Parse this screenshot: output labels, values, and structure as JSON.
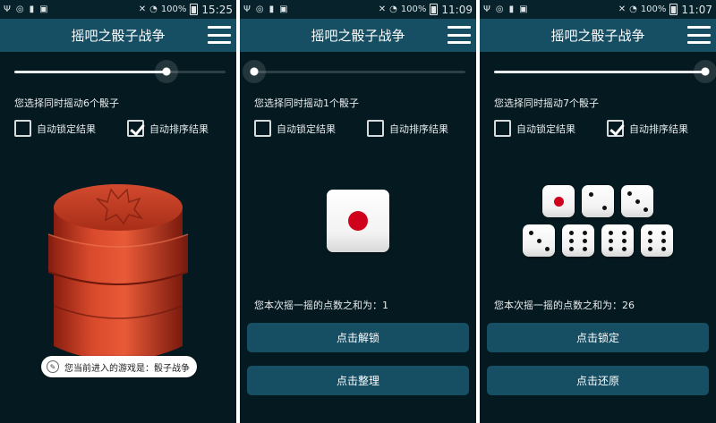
{
  "screens": [
    {
      "status": {
        "battery": "100%",
        "time": "15:25"
      },
      "title": "摇吧之骰子战争",
      "slider_value": 0.72,
      "hint": "您选择同时摇动6个骰子",
      "auto_lock_label": "自动锁定结果",
      "auto_lock_checked": false,
      "auto_sort_label": "自动排序结果",
      "auto_sort_checked": true,
      "toast": "您当前进入的游戏是：骰子战争"
    },
    {
      "status": {
        "battery": "100%",
        "time": "11:09"
      },
      "title": "摇吧之骰子战争",
      "slider_value": 0.0,
      "hint": "您选择同时摇动1个骰子",
      "auto_lock_label": "自动锁定结果",
      "auto_lock_checked": false,
      "auto_sort_label": "自动排序结果",
      "auto_sort_checked": false,
      "dice": [
        1
      ],
      "sum_text": "您本次摇一摇的点数之和为：1",
      "button1": "点击解锁",
      "button2": "点击整理"
    },
    {
      "status": {
        "battery": "100%",
        "time": "11:07"
      },
      "title": "摇吧之骰子战争",
      "slider_value": 1.0,
      "hint": "您选择同时摇动7个骰子",
      "auto_lock_label": "自动锁定结果",
      "auto_lock_checked": false,
      "auto_sort_label": "自动排序结果",
      "auto_sort_checked": true,
      "dice": [
        1,
        2,
        3,
        3,
        6,
        6,
        6
      ],
      "sum_text": "您本次摇一摇的点数之和为：26",
      "button1": "点击锁定",
      "button2": "点击还原"
    }
  ],
  "colors": {
    "background": "#051a20",
    "bar": "#164e63",
    "pip": "#111111",
    "pip_one": "#d0021b"
  }
}
